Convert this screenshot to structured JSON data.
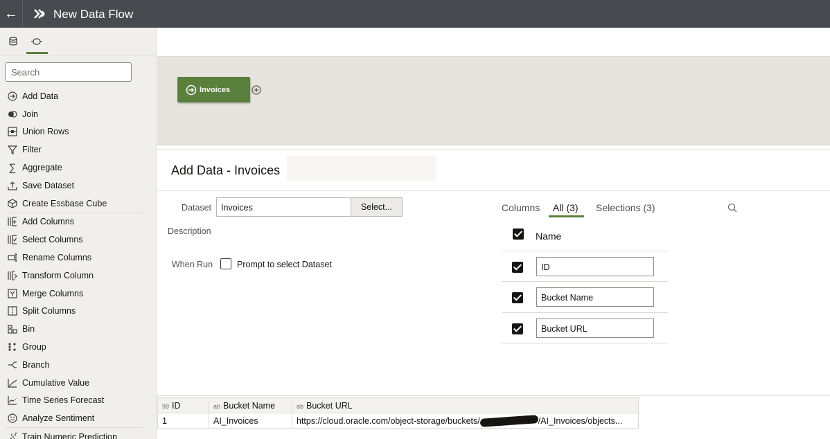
{
  "header": {
    "title": "New Data Flow",
    "back_icon": "arrow-left-icon",
    "brand_icon": "double-chevron-icon"
  },
  "sidebar": {
    "tabs": [
      {
        "name": "data-tab",
        "icon": "database-icon"
      },
      {
        "name": "steps-tab",
        "icon": "node-icon",
        "active": true
      }
    ],
    "search_placeholder": "Search",
    "items": [
      {
        "label": "Add Data",
        "icon": "add-data-icon"
      },
      {
        "label": "Join",
        "icon": "join-icon"
      },
      {
        "label": "Union Rows",
        "icon": "union-rows-icon"
      },
      {
        "label": "Filter",
        "icon": "filter-icon"
      },
      {
        "label": "Aggregate",
        "icon": "sigma-icon"
      },
      {
        "label": "Save Dataset",
        "icon": "upload-icon"
      },
      {
        "label": "Create Essbase Cube",
        "icon": "cube-icon"
      },
      {
        "label": "Add Columns",
        "icon": "add-columns-icon"
      },
      {
        "label": "Select Columns",
        "icon": "select-columns-icon"
      },
      {
        "label": "Rename Columns",
        "icon": "rename-columns-icon"
      },
      {
        "label": "Transform Column",
        "icon": "transform-column-icon"
      },
      {
        "label": "Merge Columns",
        "icon": "merge-columns-icon"
      },
      {
        "label": "Split Columns",
        "icon": "split-columns-icon"
      },
      {
        "label": "Bin",
        "icon": "bin-icon"
      },
      {
        "label": "Group",
        "icon": "group-icon"
      },
      {
        "label": "Branch",
        "icon": "branch-icon"
      },
      {
        "label": "Cumulative Value",
        "icon": "cumulative-icon"
      },
      {
        "label": "Time Series Forecast",
        "icon": "forecast-icon"
      },
      {
        "label": "Analyze Sentiment",
        "icon": "smiley-icon"
      },
      {
        "label": "Train Numeric Prediction",
        "icon": "train-icon"
      }
    ]
  },
  "canvas": {
    "node_label": "Invoices",
    "node_icon": "add-data-icon",
    "add_icon": "plus-circle-icon"
  },
  "step": {
    "title": "Add Data - Invoices",
    "dataset_label": "Dataset",
    "dataset_value": "Invoices",
    "select_button": "Select...",
    "description_label": "Description",
    "when_run_label": "When Run",
    "prompt_label": "Prompt to select Dataset",
    "prompt_checked": false
  },
  "columns_panel": {
    "label": "Columns",
    "tab_all": "All (3)",
    "tab_selections": "Selections (3)",
    "header": "Name",
    "header_checked": true,
    "rows": [
      {
        "name": "ID",
        "checked": true
      },
      {
        "name": "Bucket Name",
        "checked": true
      },
      {
        "name": "Bucket URL",
        "checked": true
      }
    ]
  },
  "preview": {
    "headers": [
      {
        "type": "99",
        "name": "ID"
      },
      {
        "type": "ab",
        "name": "Bucket Name"
      },
      {
        "type": "ab",
        "name": "Bucket URL"
      }
    ],
    "row": {
      "id": "1",
      "bucket_name": "AI_Invoices",
      "url_prefix": "https://cloud.oracle.com/object-storage/buckets/",
      "url_suffix": "/AI_Invoices/objects..."
    }
  },
  "colors": {
    "header_bg": "#474b4f",
    "accent_green": "#5b7f3d",
    "canvas_bg": "#e5e4df",
    "sidebar_bg": "#f1efed"
  }
}
